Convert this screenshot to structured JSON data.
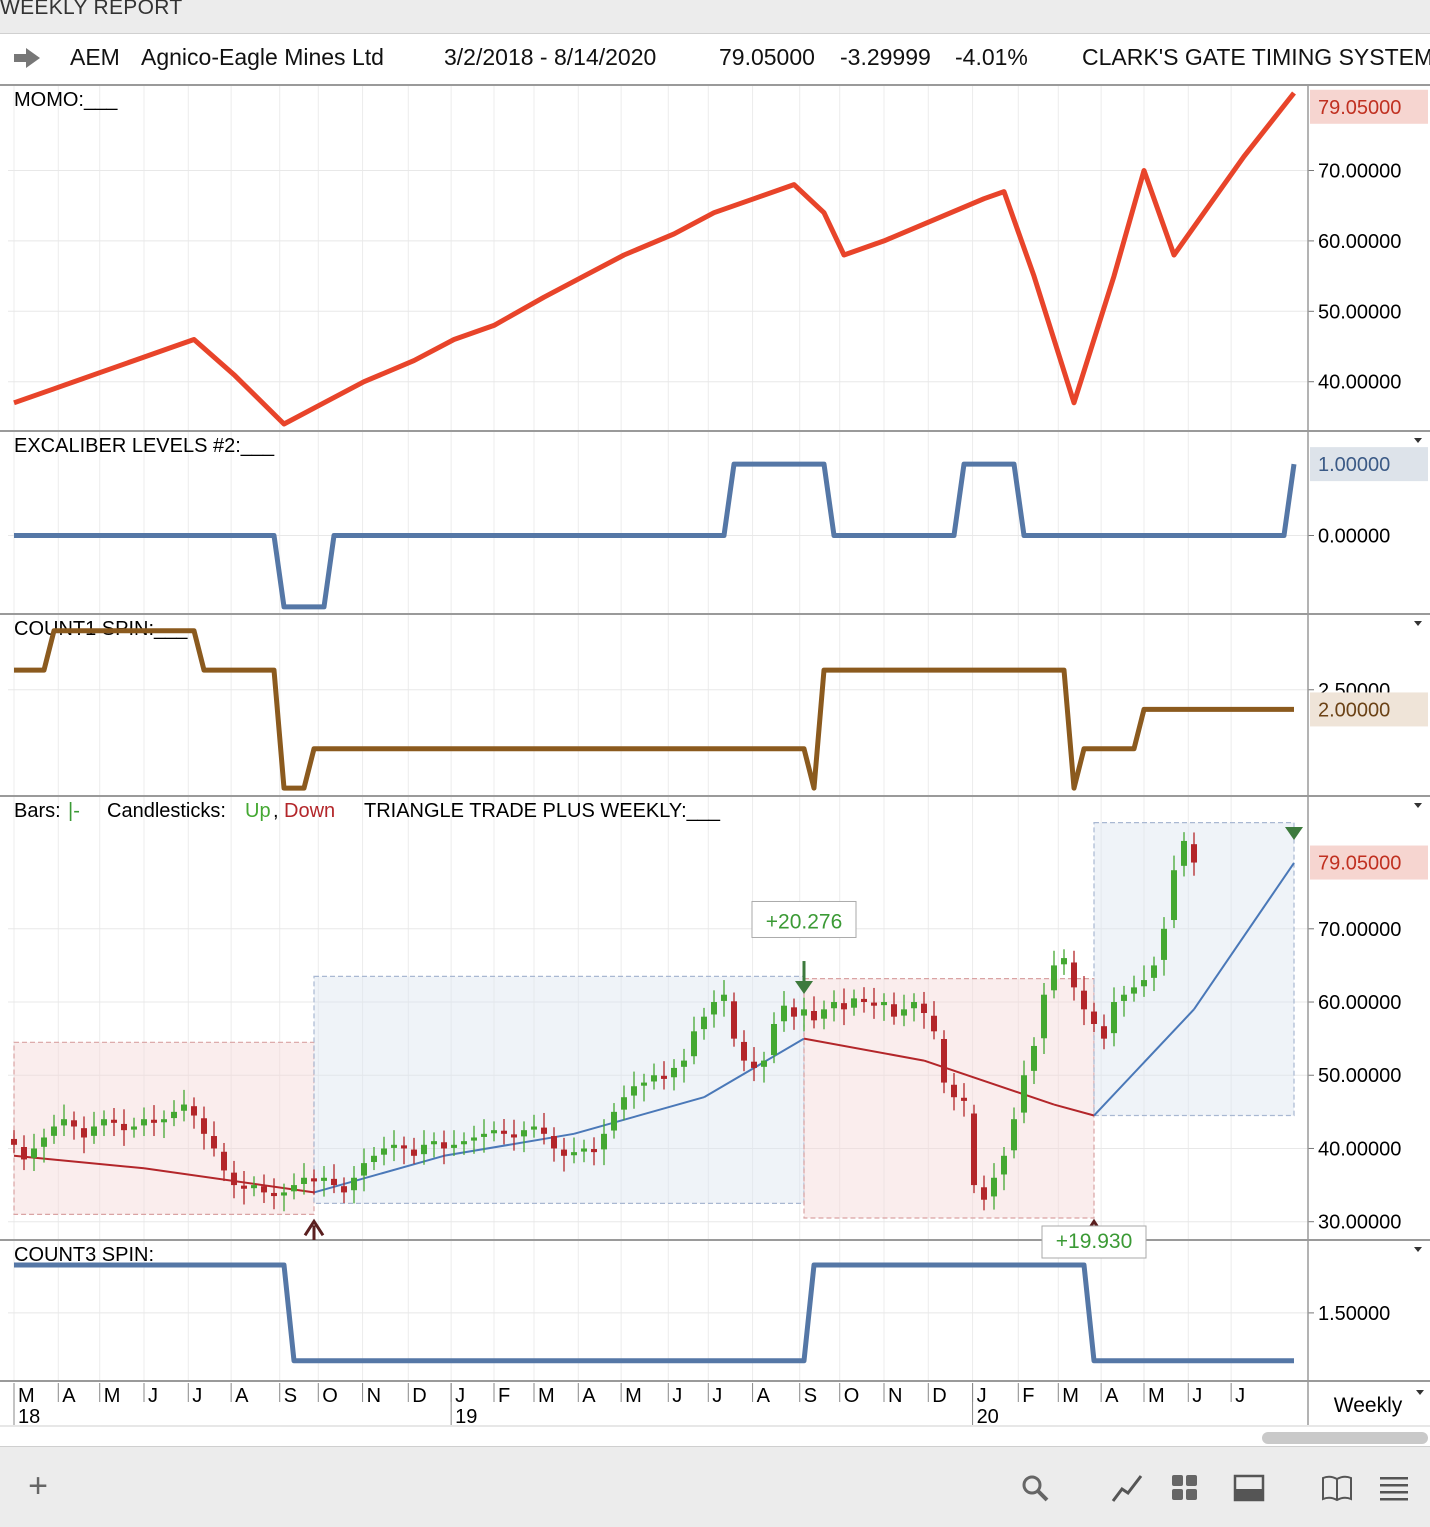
{
  "window": {
    "title": "WEEKLY REPORT"
  },
  "header": {
    "symbol": "AEM",
    "name": "Agnico-Eagle Mines Ltd",
    "date_range": "3/2/2018 - 8/14/2020",
    "last": "79.05000",
    "change": "-3.29999",
    "change_pct": "-4.01%",
    "system": "CLARK'S GATE TIMING SYSTEM"
  },
  "colors": {
    "momo": "#e8442a",
    "excal": "#5577a6",
    "count1": "#8b5a1e",
    "count3": "#5577a6",
    "up": "#44a832",
    "down": "#b3262a",
    "ma_up": "#4a78b8",
    "ma_down": "#b3262a"
  },
  "footer": {
    "timeframe": "Weekly"
  },
  "toolbar": {
    "add_icon": "plus-icon",
    "search_icon": "search-icon",
    "draw_icon": "draw-line-icon",
    "layout_icon": "grid-icon",
    "panel_icon": "panel-icon",
    "book_icon": "book-icon",
    "menu_icon": "menu-icon"
  },
  "chart_data": [
    {
      "type": "line",
      "title": "MOMO:___",
      "y_ticks": [
        "70.00000",
        "60.00000",
        "50.00000",
        "40.00000"
      ],
      "last_label": "79.05000",
      "x": [
        "2018-03-02",
        "2018-03-30",
        "2018-04-27",
        "2018-05-25",
        "2018-06-22",
        "2018-07-06",
        "2018-08-03",
        "2018-09-07",
        "2018-10-05",
        "2018-11-02",
        "2018-12-07",
        "2019-01-04",
        "2019-02-01",
        "2019-03-08",
        "2019-04-05",
        "2019-05-03",
        "2019-06-07",
        "2019-07-05",
        "2019-08-02",
        "2019-08-30",
        "2019-09-20",
        "2019-10-04",
        "2019-11-01",
        "2019-12-06",
        "2020-01-10",
        "2020-01-24",
        "2020-02-14",
        "2020-03-13",
        "2020-04-10",
        "2020-05-01",
        "2020-05-22",
        "2020-06-12",
        "2020-07-10",
        "2020-08-14"
      ],
      "values": [
        37,
        39,
        41,
        43,
        45,
        46,
        41,
        34,
        37,
        40,
        43,
        46,
        48,
        52,
        55,
        58,
        61,
        64,
        66,
        68,
        64,
        58,
        60,
        63,
        66,
        67,
        55,
        37,
        55,
        70,
        58,
        64,
        72,
        81
      ]
    },
    {
      "type": "line",
      "title": "EXCALIBER LEVELS #2:___",
      "y_ticks": [
        "0.00000"
      ],
      "last_label": "1.00000",
      "x": [
        "2018-03-02",
        "2018-08-31",
        "2018-09-07",
        "2018-10-05",
        "2018-10-12",
        "2019-07-12",
        "2019-07-19",
        "2019-09-20",
        "2019-09-27",
        "2019-12-20",
        "2019-12-27",
        "2020-01-31",
        "2020-02-07",
        "2020-08-07",
        "2020-08-14"
      ],
      "values": [
        0,
        0,
        -1,
        -1,
        0,
        0,
        1,
        1,
        0,
        0,
        1,
        1,
        0,
        0,
        1
      ]
    },
    {
      "type": "line",
      "title": "COUNT1 SPIN:___",
      "y_ticks": [
        "2.50000"
      ],
      "last_label": "2.00000",
      "x": [
        "2018-03-02",
        "2018-03-23",
        "2018-03-30",
        "2018-07-06",
        "2018-07-13",
        "2018-08-31",
        "2018-09-07",
        "2018-09-21",
        "2018-09-28",
        "2019-09-06",
        "2019-09-13",
        "2019-09-20",
        "2020-03-06",
        "2020-03-13",
        "2020-03-20",
        "2020-04-24",
        "2020-05-01",
        "2020-08-14"
      ],
      "values": [
        3,
        3,
        4,
        4,
        3,
        3,
        0,
        0,
        1,
        1,
        0,
        3,
        3,
        0,
        1,
        1,
        2,
        2
      ]
    },
    {
      "type": "candlestick",
      "title": "TRIANGLE TRADE PLUS WEEKLY:___",
      "legend": {
        "bars": "Bars:",
        "bars_mark": "|-",
        "candles": "Candlesticks:",
        "up": "Up",
        "comma": ",",
        "down": "Down"
      },
      "y_ticks": [
        "70.00000",
        "60.00000",
        "50.00000",
        "40.00000",
        "30.00000"
      ],
      "last_label": "79.05000",
      "annotations": [
        {
          "text": "+20.276",
          "x": "2019-09-06",
          "y": 71
        },
        {
          "text": "+19.930",
          "x": "2020-03-27",
          "y": 28
        }
      ],
      "zones": [
        {
          "kind": "down",
          "x": [
            "2018-03-02",
            "2018-09-28"
          ],
          "y": [
            31,
            54.5
          ]
        },
        {
          "kind": "up",
          "x": [
            "2018-09-28",
            "2019-09-06"
          ],
          "y": [
            32.5,
            63.5
          ]
        },
        {
          "kind": "down",
          "x": [
            "2019-09-06",
            "2020-03-27"
          ],
          "y": [
            30.5,
            63.2
          ]
        },
        {
          "kind": "up",
          "x": [
            "2020-03-27",
            "2020-08-14"
          ],
          "y": [
            44.5,
            84.5
          ]
        }
      ],
      "signals": [
        {
          "dir": "up",
          "x": "2018-09-28"
        },
        {
          "dir": "down",
          "x": "2019-09-06"
        },
        {
          "dir": "up",
          "x": "2020-03-27"
        },
        {
          "dir": "down",
          "x": "2020-08-14"
        }
      ],
      "ma": [
        {
          "x": "2018-03-02",
          "y": 39.0
        },
        {
          "x": "2018-06-01",
          "y": 37.3
        },
        {
          "x": "2018-09-28",
          "y": 34.0
        },
        {
          "x": "2018-12-28",
          "y": 39.0
        },
        {
          "x": "2019-03-29",
          "y": 42.0
        },
        {
          "x": "2019-06-28",
          "y": 47.0
        },
        {
          "x": "2019-09-06",
          "y": 55.0
        },
        {
          "x": "2019-11-29",
          "y": 52.0
        },
        {
          "x": "2020-02-28",
          "y": 46.0
        },
        {
          "x": "2020-03-27",
          "y": 44.5
        },
        {
          "x": "2020-06-05",
          "y": 59.0
        },
        {
          "x": "2020-08-14",
          "y": 79.0
        }
      ],
      "ohlc_close": [
        40.5,
        38.5,
        40,
        41.5,
        43,
        44,
        43,
        41.5,
        43,
        44,
        43.5,
        42.5,
        43,
        44,
        43.5,
        44,
        45,
        46,
        44.5,
        42,
        40,
        37,
        35,
        34.5,
        35,
        34,
        33.5,
        34,
        35,
        36,
        35.5,
        36,
        35,
        34,
        36,
        38,
        39,
        40,
        40.5,
        40,
        39,
        40.5,
        41,
        40,
        40.5,
        41,
        41.5,
        42,
        42.5,
        42,
        41.5,
        42.5,
        43,
        42,
        40,
        39,
        39.5,
        40,
        39.5,
        42,
        45,
        47,
        48.5,
        49,
        50,
        49.5,
        51,
        52,
        56,
        58,
        60,
        61,
        55,
        52,
        51,
        52,
        57,
        59.5,
        58,
        59,
        57.5,
        59,
        60,
        59,
        60.5,
        60,
        59.5,
        60,
        58,
        59,
        60,
        58.5,
        56,
        49,
        47,
        46.5,
        35,
        33,
        36,
        39,
        44,
        50,
        54,
        61,
        65,
        66,
        62,
        59,
        57,
        55,
        60,
        61,
        62,
        63,
        65,
        70,
        78,
        82,
        79.05
      ]
    },
    {
      "type": "line",
      "title": "COUNT3 SPIN:___",
      "y_ticks": [
        "1.50000"
      ],
      "x": [
        "2018-03-02",
        "2018-09-07",
        "2018-09-14",
        "2019-09-06",
        "2019-09-13",
        "2020-03-20",
        "2020-03-27",
        "2020-08-14"
      ],
      "values": [
        2,
        2,
        1,
        1,
        2,
        2,
        1,
        1
      ]
    }
  ],
  "x_axis": {
    "months": [
      {
        "label": "M",
        "x": "2018-03-02"
      },
      {
        "label": "A",
        "x": "2018-04-02"
      },
      {
        "label": "M",
        "x": "2018-05-01"
      },
      {
        "label": "J",
        "x": "2018-06-01"
      },
      {
        "label": "J",
        "x": "2018-07-02"
      },
      {
        "label": "A",
        "x": "2018-08-01"
      },
      {
        "label": "S",
        "x": "2018-09-04"
      },
      {
        "label": "O",
        "x": "2018-10-01"
      },
      {
        "label": "N",
        "x": "2018-11-01"
      },
      {
        "label": "D",
        "x": "2018-12-03"
      },
      {
        "label": "J",
        "x": "2019-01-02"
      },
      {
        "label": "F",
        "x": "2019-02-01"
      },
      {
        "label": "M",
        "x": "2019-03-01"
      },
      {
        "label": "A",
        "x": "2019-04-01"
      },
      {
        "label": "M",
        "x": "2019-05-01"
      },
      {
        "label": "J",
        "x": "2019-06-03"
      },
      {
        "label": "J",
        "x": "2019-07-01"
      },
      {
        "label": "A",
        "x": "2019-08-01"
      },
      {
        "label": "S",
        "x": "2019-09-03"
      },
      {
        "label": "O",
        "x": "2019-10-01"
      },
      {
        "label": "N",
        "x": "2019-11-01"
      },
      {
        "label": "D",
        "x": "2019-12-02"
      },
      {
        "label": "J",
        "x": "2020-01-02"
      },
      {
        "label": "F",
        "x": "2020-02-03"
      },
      {
        "label": "M",
        "x": "2020-03-02"
      },
      {
        "label": "A",
        "x": "2020-04-01"
      },
      {
        "label": "M",
        "x": "2020-05-01"
      },
      {
        "label": "J",
        "x": "2020-06-01"
      },
      {
        "label": "J",
        "x": "2020-07-01"
      }
    ],
    "years": [
      {
        "label": "18",
        "x": "2018-03-02"
      },
      {
        "label": "19",
        "x": "2019-01-02"
      },
      {
        "label": "20",
        "x": "2020-01-02"
      }
    ]
  }
}
